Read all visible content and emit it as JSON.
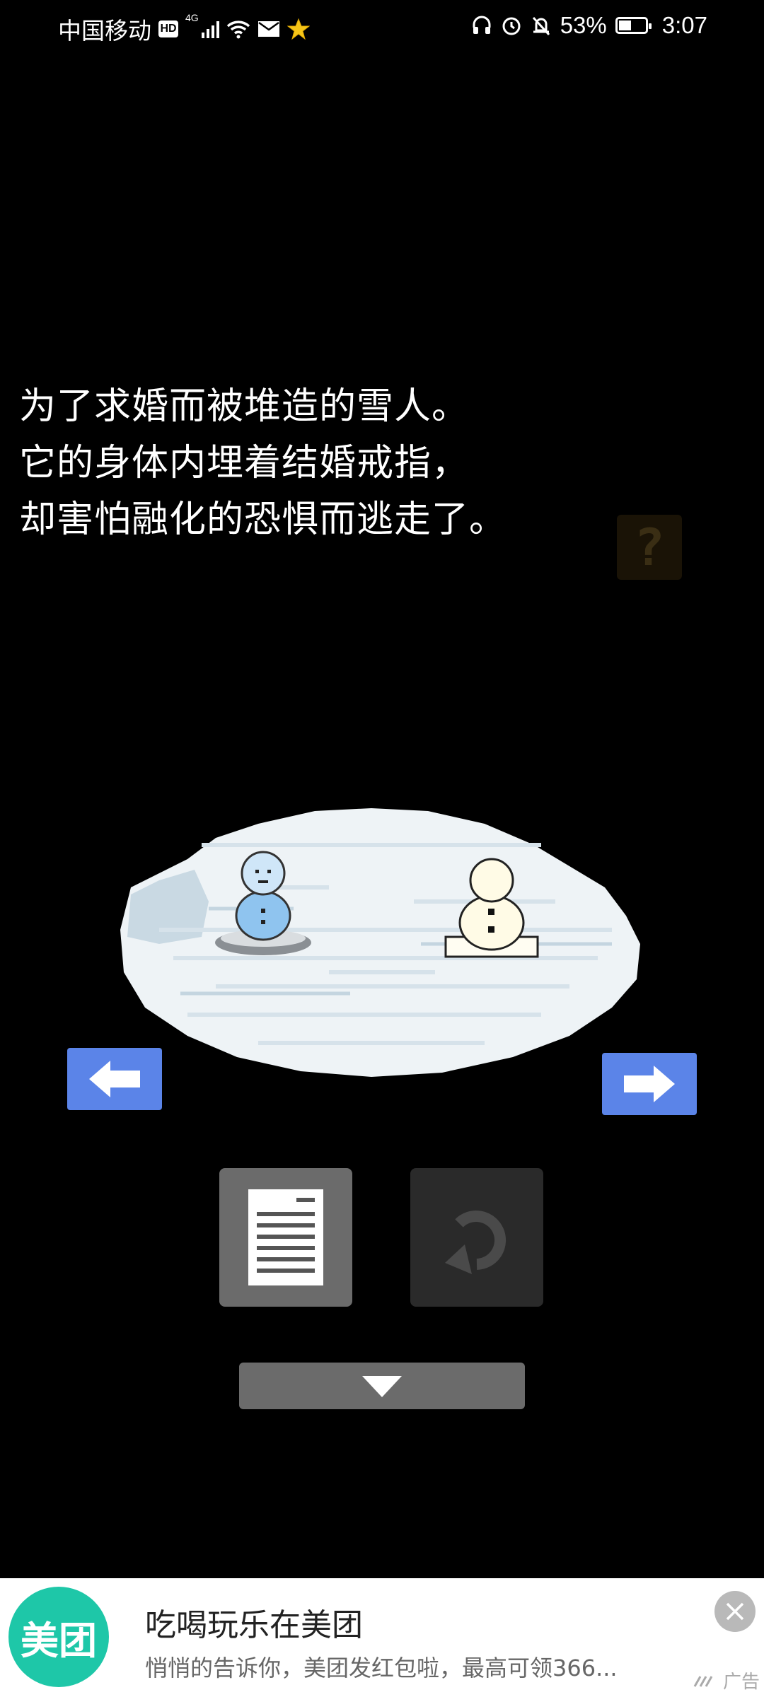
{
  "status_bar": {
    "carrier": "中国移动",
    "hd": "HD",
    "network": "4G",
    "battery_percent": "53%",
    "battery_level": 0.53,
    "time": "3:07",
    "icons": [
      "hd-icon",
      "signal-icon",
      "wifi-icon",
      "mail-icon",
      "star-icon",
      "headset-icon",
      "alarm-icon",
      "mute-icon",
      "battery-icon"
    ]
  },
  "story": {
    "lines": [
      "为了求婚而被堆造的雪人。",
      "它的身体内埋着结婚戒指，",
      "却害怕融化的恐惧而逃走了。"
    ]
  },
  "hint_button": {
    "label": "?"
  },
  "nav": {
    "left_icon": "arrow-left-icon",
    "right_icon": "arrow-right-icon"
  },
  "buttons": {
    "document_icon": "document-icon",
    "undo_icon": "undo-icon",
    "expand_icon": "chevron-down-icon"
  },
  "ad": {
    "logo_text": "美团",
    "title": "吃喝玩乐在美团",
    "description": "悄悄的告诉你，美团发红包啦，最高可领366...",
    "tag": "广告",
    "accent": "#1ec7a8"
  },
  "colors": {
    "background": "#000000",
    "arrow_blue": "#5b84e8",
    "button_gray": "#6b6b6b",
    "button_dark": "#2a2a2a"
  }
}
